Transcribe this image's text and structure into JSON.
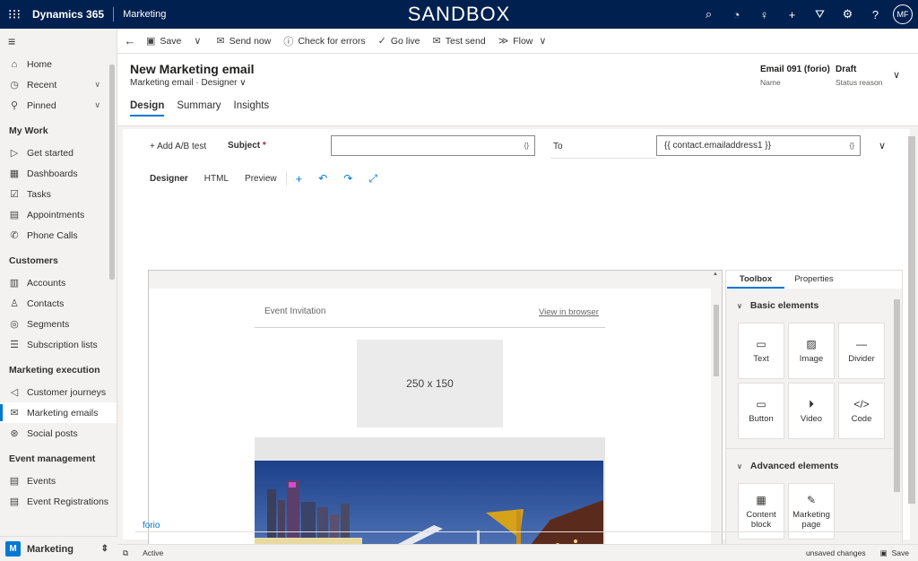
{
  "topbar": {
    "app_name": "Dynamics 365",
    "module": "Marketing",
    "environment": "SANDBOX",
    "user_initials": "MF",
    "icons": [
      "search-icon",
      "task-icon",
      "lightbulb-icon",
      "plus-icon",
      "filter-icon",
      "gear-icon",
      "help-icon"
    ]
  },
  "sidebar": {
    "top_items": [
      {
        "label": "Home",
        "icon": "home-icon"
      },
      {
        "label": "Recent",
        "icon": "clock-icon"
      },
      {
        "label": "Pinned",
        "icon": "pin-icon"
      }
    ],
    "groups": [
      {
        "heading": "My Work",
        "items": [
          {
            "label": "Get started",
            "icon": "play-icon"
          },
          {
            "label": "Dashboards",
            "icon": "dashboard-icon"
          },
          {
            "label": "Tasks",
            "icon": "task-list-icon"
          },
          {
            "label": "Appointments",
            "icon": "calendar-icon"
          },
          {
            "label": "Phone Calls",
            "icon": "phone-icon"
          }
        ]
      },
      {
        "heading": "Customers",
        "items": [
          {
            "label": "Accounts",
            "icon": "building-icon"
          },
          {
            "label": "Contacts",
            "icon": "person-icon"
          },
          {
            "label": "Segments",
            "icon": "segment-icon"
          },
          {
            "label": "Subscription lists",
            "icon": "list-icon"
          }
        ]
      },
      {
        "heading": "Marketing execution",
        "items": [
          {
            "label": "Customer journeys",
            "icon": "megaphone-icon"
          },
          {
            "label": "Marketing emails",
            "icon": "mail-icon"
          },
          {
            "label": "Social posts",
            "icon": "social-icon"
          }
        ]
      },
      {
        "heading": "Event management",
        "items": [
          {
            "label": "Events",
            "icon": "event-icon"
          },
          {
            "label": "Event Registrations",
            "icon": "registration-icon"
          }
        ]
      }
    ],
    "area_letter": "M",
    "area_name": "Marketing"
  },
  "commands": [
    {
      "label": "Save",
      "icon": "save-icon"
    },
    {
      "label": "Send now",
      "icon": "send-icon"
    },
    {
      "label": "Check for errors",
      "icon": "warning-icon"
    },
    {
      "label": "Go live",
      "icon": "check-circle-icon"
    },
    {
      "label": "Test send",
      "icon": "mail-icon"
    },
    {
      "label": "Flow",
      "icon": "flow-icon"
    }
  ],
  "record": {
    "title": "New Marketing email",
    "entity": "Marketing email",
    "form": "Designer",
    "name_value": "Email 091 (forio)",
    "name_label": "Name",
    "status_value": "Draft",
    "status_label": "Status reason"
  },
  "tabs": [
    "Design",
    "Summary",
    "Insights"
  ],
  "editor": {
    "ab_test": "Add A/B test",
    "subject_label": "Subject",
    "subject_required": "*",
    "subject_value": "",
    "to_label": "To",
    "to_value": "{{ contact.emailaddress1 }}",
    "brace_glyph": "{}",
    "modes": [
      "Designer",
      "HTML",
      "Preview"
    ],
    "footer_link": "forio"
  },
  "canvas": {
    "preheader": "Event Invitation",
    "view_in_browser": "View in browser",
    "placeholder": "250 x 150"
  },
  "toolbox": {
    "tabs": [
      "Toolbox",
      "Properties"
    ],
    "basic_title": "Basic elements",
    "basic": [
      {
        "label": "Text",
        "icon": "text-icon"
      },
      {
        "label": "Image",
        "icon": "image-icon"
      },
      {
        "label": "Divider",
        "icon": "divider-icon"
      },
      {
        "label": "Button",
        "icon": "button-icon"
      },
      {
        "label": "Video",
        "icon": "video-icon"
      },
      {
        "label": "Code",
        "icon": "code-icon"
      }
    ],
    "advanced_title": "Advanced elements",
    "advanced": [
      {
        "label": "Content block",
        "icon": "content-block-icon"
      },
      {
        "label": "Marketing page",
        "icon": "marketing-page-icon"
      }
    ]
  },
  "status": {
    "state": "Active",
    "unsaved": "unsaved changes",
    "save": "Save"
  }
}
